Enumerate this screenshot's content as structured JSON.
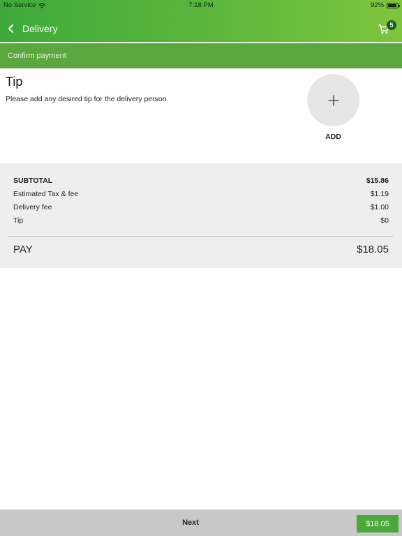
{
  "status_bar": {
    "carrier": "No Service",
    "time": "7:18 PM",
    "battery": "92%"
  },
  "header": {
    "title": "Delivery",
    "cart_count": "5"
  },
  "confirm_bar": {
    "label": "Confirm payment"
  },
  "tip": {
    "title": "Tip",
    "description": "Please add any desired tip for the delivery person.",
    "add_label": "ADD"
  },
  "summary": {
    "rows": [
      {
        "label": "SUBTOTAL",
        "value": "$15.86"
      },
      {
        "label": "Estimated Tax & fee",
        "value": "$1.19"
      },
      {
        "label": "Delivery fee",
        "value": "$1.00"
      },
      {
        "label": "Tip",
        "value": "$0"
      }
    ],
    "pay_label": "PAY",
    "pay_value": "$18.05"
  },
  "footer": {
    "next_label": "Next",
    "pay_button_label": "$18.05"
  },
  "colors": {
    "brand_green": "#4aa83a",
    "header_gradient_end": "#7ec53d",
    "confirm_bar": "#5aa83d"
  }
}
